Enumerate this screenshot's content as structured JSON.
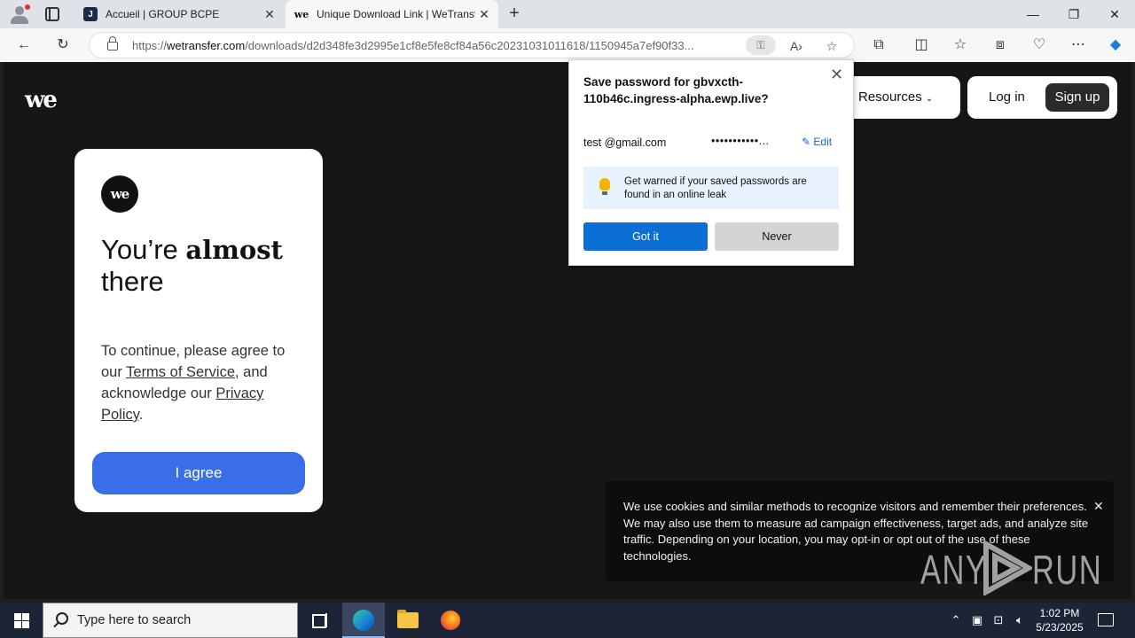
{
  "browser": {
    "tabs": [
      {
        "favicon": "J",
        "title": "Accueil | GROUP BCPE"
      },
      {
        "favicon": "we",
        "title": "Unique Download Link | WeTransfer"
      }
    ],
    "url_domain": "wetransfer.com",
    "url_prefix": "https://",
    "url_path": "/downloads/d2d348fe3d2995e1cf8e5fe8cf84a56c20231031011618/1150945a7ef90f33..."
  },
  "site": {
    "logo": "we",
    "nav": {
      "resources": "Resources",
      "login": "Log in",
      "signup": "Sign up"
    }
  },
  "card": {
    "logo": "we",
    "heading_pre": "You’re ",
    "heading_bold": "almost",
    "heading_post": "there",
    "text_pre": "To continue, please agree to our ",
    "terms_link": "Terms of Service",
    "text_mid": ", and acknowledge our ",
    "privacy_link": "Privacy Policy",
    "text_post": ".",
    "agree_button": "I agree"
  },
  "cookie": {
    "text": "We use cookies and similar methods to recognize visitors and remember their preferences. We may also use them to measure ad campaign effectiveness, target ads, and analyze site traffic. Depending on your location, you may opt-in or opt out of the use of these technologies."
  },
  "password_popup": {
    "title": "Save password for gbvxcth-110b46c.ingress-alpha.ewp.live?",
    "username": "test @gmail.com",
    "password_mask": "•••••••••••...",
    "edit": "Edit",
    "warning": "Get warned if your saved passwords are found in an online leak",
    "got_it": "Got it",
    "never": "Never"
  },
  "watermark": {
    "left": "ANY",
    "right": "RUN"
  },
  "taskbar": {
    "search_placeholder": "Type here to search",
    "time": "1:02 PM",
    "date": "5/23/2025"
  },
  "colors": {
    "accent": "#3a6ee8",
    "edge_blue": "#0b6fd6",
    "page_bg": "#161616"
  }
}
